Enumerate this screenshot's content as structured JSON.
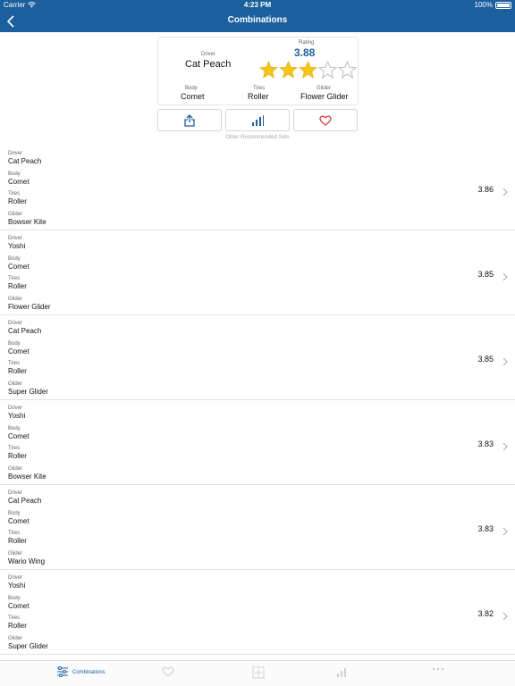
{
  "status": {
    "carrier": "Carrier",
    "time": "4:23 PM",
    "battery": "100%"
  },
  "nav": {
    "title": "Combinations"
  },
  "selected": {
    "driver_label": "Driver",
    "driver": "Cat Peach",
    "rating_label": "Rating",
    "rating": "3.88",
    "body_label": "Body",
    "body": "Comet",
    "tires_label": "Tires",
    "tires": "Roller",
    "glider_label": "Glider",
    "glider": "Flower Glider",
    "stars_filled": 3,
    "stars_total": 5
  },
  "actions": {
    "share_icon": "share-icon",
    "stats_icon": "bar-chart-icon",
    "favorite_icon": "heart-icon"
  },
  "section_title": "Other Recommended Sets",
  "labels": {
    "driver": "Driver",
    "body": "Body",
    "tires": "Tires",
    "glider": "Glider"
  },
  "rows": [
    {
      "driver": "Cat Peach",
      "body": "Comet",
      "tires": "Roller",
      "glider": "Bowser Kite",
      "score": "3.86"
    },
    {
      "driver": "Yoshi",
      "body": "Comet",
      "tires": "Roller",
      "glider": "Flower Glider",
      "score": "3.85"
    },
    {
      "driver": "Cat Peach",
      "body": "Comet",
      "tires": "Roller",
      "glider": "Super Glider",
      "score": "3.85"
    },
    {
      "driver": "Yoshi",
      "body": "Comet",
      "tires": "Roller",
      "glider": "Bowser Kite",
      "score": "3.83"
    },
    {
      "driver": "Cat Peach",
      "body": "Comet",
      "tires": "Roller",
      "glider": "Wario Wing",
      "score": "3.83"
    },
    {
      "driver": "Yoshi",
      "body": "Comet",
      "tires": "Roller",
      "glider": "Super Glider",
      "score": "3.82"
    }
  ],
  "tabs": [
    {
      "label": "Combinations",
      "icon": "sliders-icon",
      "active": true
    },
    {
      "label": "",
      "icon": "heart-icon",
      "active": false
    },
    {
      "label": "",
      "icon": "plus-square-icon",
      "active": false
    },
    {
      "label": "",
      "icon": "bar-chart-icon",
      "active": false
    },
    {
      "label": "",
      "icon": "more-icon",
      "active": false
    }
  ],
  "colors": {
    "accent": "#1a5f9e",
    "star": "#f5c518"
  }
}
